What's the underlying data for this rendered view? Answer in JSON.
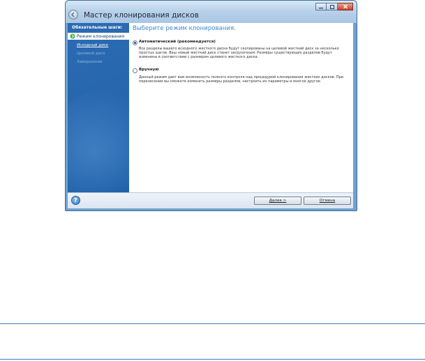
{
  "window": {
    "title": "Мастер клонирования дисков",
    "controls": {
      "minimize": "–",
      "maximize": "□",
      "close": "✕"
    }
  },
  "sidebar": {
    "header": "Обязательные шаги:",
    "current_step": "Режим клонирования",
    "steps": [
      {
        "label": "Исходный диск",
        "state": "link"
      },
      {
        "label": "Целевой диск",
        "state": "disabled"
      },
      {
        "label": "Завершение",
        "state": "disabled"
      }
    ]
  },
  "main": {
    "title": "Выберите режим клонирования.",
    "options": [
      {
        "label": "Автоматический (рекомендуется)",
        "selected": true,
        "description": "Все разделы вашего исходного жесткого диска будут скопированы на целевой жесткий диск за несколько простых шагов. Ваш новый жесткий диск станет загрузочным. Размеры существующих разделов будут изменены в соответствии с размером целевого жесткого диска."
      },
      {
        "label": "Вручную",
        "selected": false,
        "description": "Данный режим дает вам возможность полного контроля над процедурой клонирования жестких дисков. При перенесении вы сможете изменить размеры разделов, настроить их параметры и многое другое."
      }
    ]
  },
  "footer": {
    "help_icon": "?",
    "next_label": "Далее >",
    "cancel_label": "Отмена"
  },
  "colors": {
    "sidebar": "#2766ad",
    "accent_title": "#3a8ad0",
    "rule": "#3a7bbf"
  }
}
